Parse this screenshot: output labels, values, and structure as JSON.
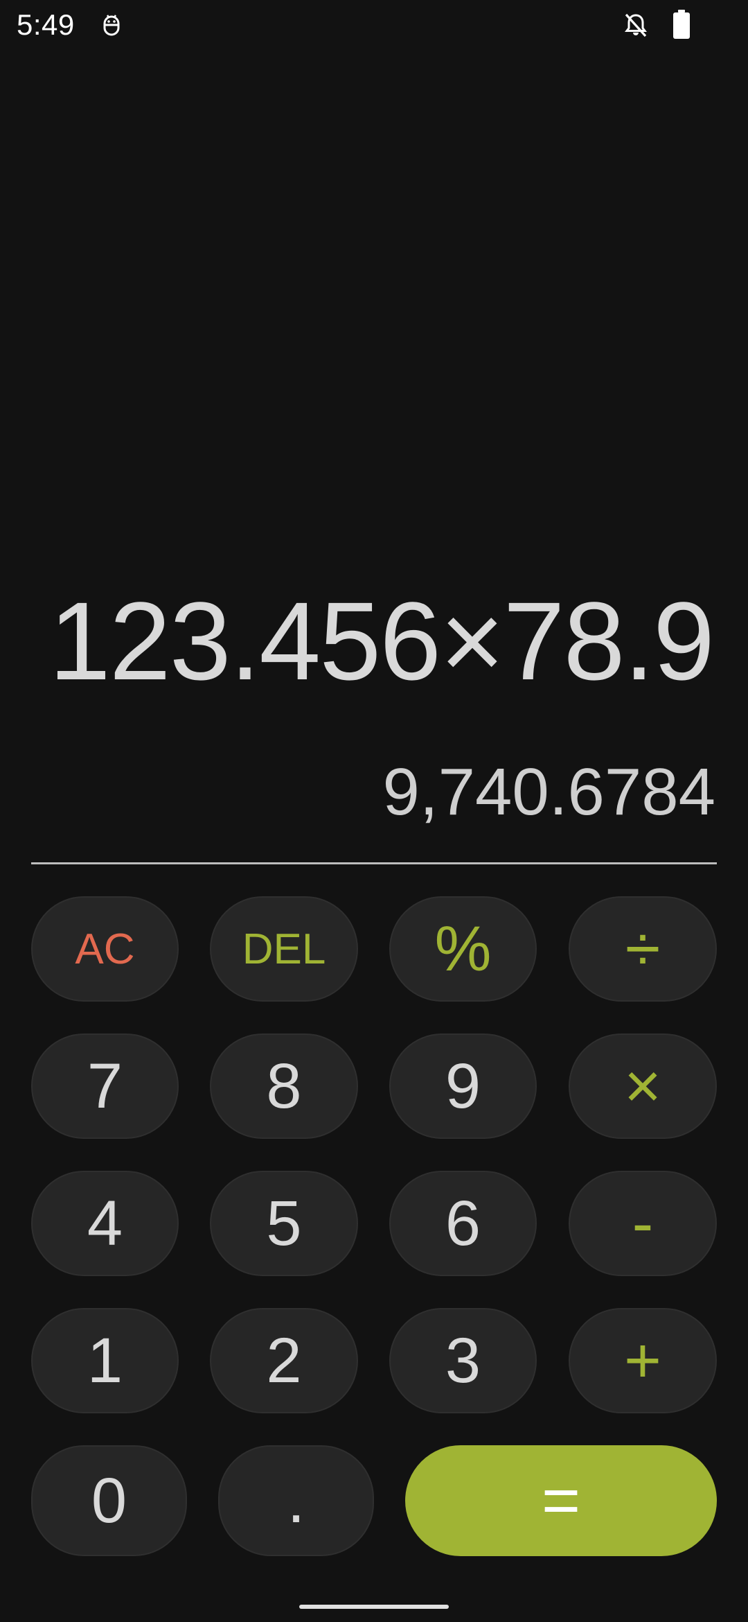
{
  "status_bar": {
    "time": "5:49",
    "app_icon": "android-icon",
    "bell_icon": "bell-off-icon",
    "battery_icon": "battery-full-icon"
  },
  "display": {
    "expression": "123.456×78.9",
    "result": "9,740.6784"
  },
  "keys": {
    "ac": "AC",
    "del": "DEL",
    "percent": "%",
    "divide": "÷",
    "seven": "7",
    "eight": "8",
    "nine": "9",
    "multiply": "×",
    "four": "4",
    "five": "5",
    "six": "6",
    "minus": "-",
    "one": "1",
    "two": "2",
    "three": "3",
    "plus": "+",
    "zero": "0",
    "decimal": ".",
    "equals": "="
  },
  "colors": {
    "background": "#121212",
    "key": "#262626",
    "accent": "#a0b434",
    "clear": "#e2694f",
    "text": "#d9d9d9"
  }
}
